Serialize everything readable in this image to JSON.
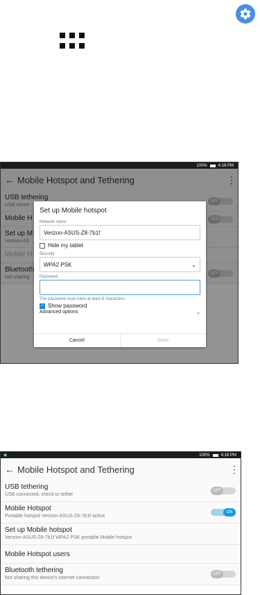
{
  "top": {
    "settings_icon": "gear-icon",
    "apps_icon": "apps-grid-icon"
  },
  "status": {
    "battery": "100%",
    "time": "4:18 PM"
  },
  "screen1": {
    "title": "Mobile Hotspot and Tethering",
    "rows": [
      {
        "title": "USB tethering",
        "subtitle": "USB conne",
        "toggle": "OFF"
      },
      {
        "title": "Mobile H",
        "subtitle": "",
        "toggle": "OFF"
      },
      {
        "title": "Set up M",
        "subtitle": "Verizon-AS"
      },
      {
        "title": "Mobile H",
        "subtitle": ""
      },
      {
        "title": "Bluetooth",
        "subtitle": "Not sharing",
        "toggle": "OFF"
      }
    ],
    "dialog": {
      "title": "Set up Mobile hotspot",
      "network_label": "Network name",
      "network_value": "Verizon-ASUS-Z8-7b1f",
      "hide_label": "Hide my tablet",
      "security_label": "Security",
      "security_value": "WPA2 PSK",
      "password_label": "Password",
      "password_value": "",
      "hint": "The password must have at least 8 characters.",
      "show_password_label": "Show password",
      "advanced_label": "Advanced options",
      "cancel": "Cancel",
      "save": "Save"
    }
  },
  "screen2": {
    "title": "Mobile Hotspot and Tethering",
    "rows": [
      {
        "title": "USB tethering",
        "subtitle": "USB connected, check to tether",
        "toggle": "OFF"
      },
      {
        "title": "Mobile Hotspot",
        "subtitle": "Portable hotspot Verizon-ASUS-Z8-7b1f active",
        "toggle": "ON"
      },
      {
        "title": "Set up Mobile hotspot",
        "subtitle": "Verizon-ASUS-Z8-7b1f WPA2 PSK portable Mobile hotspot"
      },
      {
        "title": "Mobile Hotspot users",
        "subtitle": ""
      },
      {
        "title": "Bluetooth tethering",
        "subtitle": "Not sharing this device's internet connection",
        "toggle": "OFF"
      }
    ]
  }
}
